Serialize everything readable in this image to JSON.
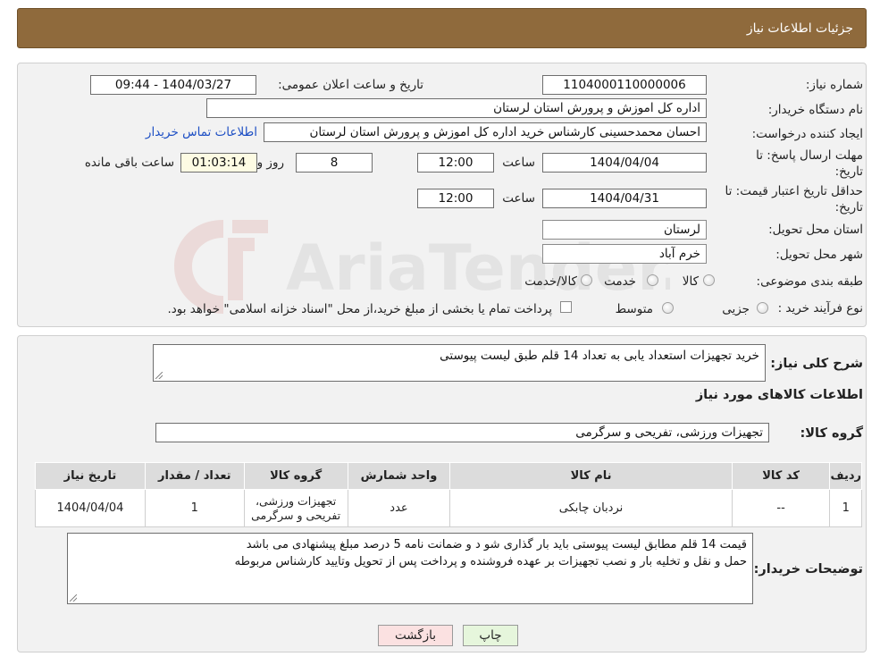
{
  "header": {
    "title": "جزئیات اطلاعات نیاز"
  },
  "form": {
    "need_number": {
      "label": "شماره نیاز:",
      "value": "1104000110000006"
    },
    "announce_datetime": {
      "label": "تاریخ و ساعت اعلان عمومی:",
      "value": "1404/03/27 - 09:44"
    },
    "buyer_org": {
      "label": "نام دستگاه خريدار:",
      "value": "اداره کل اموزش و پرورش استان لرستان"
    },
    "requester": {
      "label": "ایجاد کننده درخواست:",
      "value": "احسان محمدحسینی کارشناس خرید اداره کل اموزش و پرورش استان لرستان",
      "contact_link": "اطلاعات تماس خریدار"
    },
    "reply_deadline": {
      "label": "مهلت ارسال پاسخ: تا تاریخ:",
      "date": "1404/04/04",
      "time_label": "ساعت",
      "time": "12:00",
      "days": "8",
      "days_label": "روز و",
      "remaining": "01:03:14",
      "remaining_label": "ساعت باقی مانده"
    },
    "price_validity": {
      "label": "حداقل تاریخ اعتبار قیمت: تا تاریخ:",
      "date": "1404/04/31",
      "time_label": "ساعت",
      "time": "12:00"
    },
    "province": {
      "label": "استان محل تحویل:",
      "value": "لرستان"
    },
    "city": {
      "label": "شهر محل تحویل:",
      "value": "خرم آباد"
    },
    "category": {
      "label": "طبقه بندی موضوعی:",
      "options": [
        "کالا",
        "خدمت",
        "کالا/خدمت"
      ]
    },
    "purchase_type": {
      "label": "نوع فرآیند خرید :",
      "options": [
        "جزیی",
        "متوسط"
      ],
      "note": "پرداخت تمام یا بخشی از مبلغ خرید،از محل \"اسناد خزانه اسلامی\" خواهد بود."
    }
  },
  "details": {
    "summary_label": "شرح کلی نیاز:",
    "summary_value": "خرید تجهیزات استعداد یابی به تعداد 14 قلم طبق لیست پیوستی",
    "goods_info_title": "اطلاعات کالاهای مورد نیاز",
    "goods_group_label": "گروه کالا:",
    "goods_group_value": "تجهیزات ورزشی، تفریحی و سرگرمی"
  },
  "table": {
    "headers": [
      "ردیف",
      "کد کالا",
      "نام کالا",
      "واحد شمارش",
      "گروه کالا",
      "تعداد / مقدار",
      "تاریخ نیاز"
    ],
    "rows": [
      [
        "1",
        "--",
        "نردبان چابکی",
        "عدد",
        "تجهیزات ورزشی، تفریحی و سرگرمی",
        "1",
        "1404/04/04"
      ]
    ]
  },
  "buyer_notes": {
    "label": "توضیحات خریدار:",
    "line1": "قیمت  14 قلم مطابق لیست پیوستی باید بار گذاری شو د و ضمانت نامه  5 درصد مبلغ پیشنهادی می باشد",
    "line2": "حمل و نقل و تخلیه بار و نصب تجهیزات بر عهده فروشنده و پرداخت پس از تحویل وتایید کارشناس مربوطه"
  },
  "buttons": {
    "print": "چاپ",
    "back": "بازگشت"
  },
  "watermark": {
    "text": "AriaTender.neT"
  },
  "colors": {
    "header_bg": "#8f6a3c",
    "link": "#1d4fc4",
    "print_bg": "#e6f6dc",
    "back_bg": "#fbe1e1"
  }
}
